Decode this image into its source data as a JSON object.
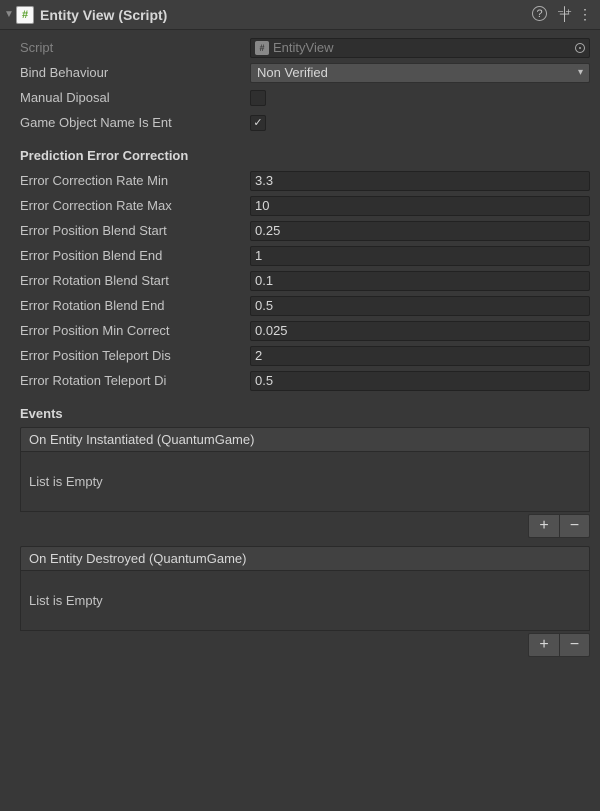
{
  "header": {
    "title": "Entity View (Script)",
    "foldout": "▼",
    "script_icon_glyph": "#",
    "help_icon": "?",
    "preset_icon": "⇄",
    "menu_icon": "⋮"
  },
  "fields": {
    "script": {
      "label": "Script",
      "value": "EntityView",
      "icon_glyph": "#"
    },
    "bind_behaviour": {
      "label": "Bind Behaviour",
      "value": "Non Verified"
    },
    "manual_disposal": {
      "label": "Manual Diposal",
      "checked": false
    },
    "game_object_name_is_ent": {
      "label": "Game Object Name Is Ent",
      "checked": true
    }
  },
  "prediction_section": {
    "title": "Prediction Error Correction",
    "rows": [
      {
        "label": "Error Correction Rate Min",
        "value": "3.3"
      },
      {
        "label": "Error Correction Rate Max",
        "value": "10"
      },
      {
        "label": "Error Position Blend Start",
        "value": "0.25"
      },
      {
        "label": "Error Position Blend End",
        "value": "1"
      },
      {
        "label": "Error Rotation Blend Start",
        "value": "0.1"
      },
      {
        "label": "Error Rotation Blend End",
        "value": "0.5"
      },
      {
        "label": "Error Position Min Correct",
        "value": "0.025"
      },
      {
        "label": "Error Position Teleport Dis",
        "value": "2"
      },
      {
        "label": "Error Rotation Teleport Di",
        "value": "0.5"
      }
    ]
  },
  "events_section": {
    "title": "Events",
    "blocks": [
      {
        "header": "On Entity Instantiated (QuantumGame)",
        "body": "List is Empty"
      },
      {
        "header": "On Entity Destroyed (QuantumGame)",
        "body": "List is Empty"
      }
    ],
    "plus": "+",
    "minus": "−"
  }
}
